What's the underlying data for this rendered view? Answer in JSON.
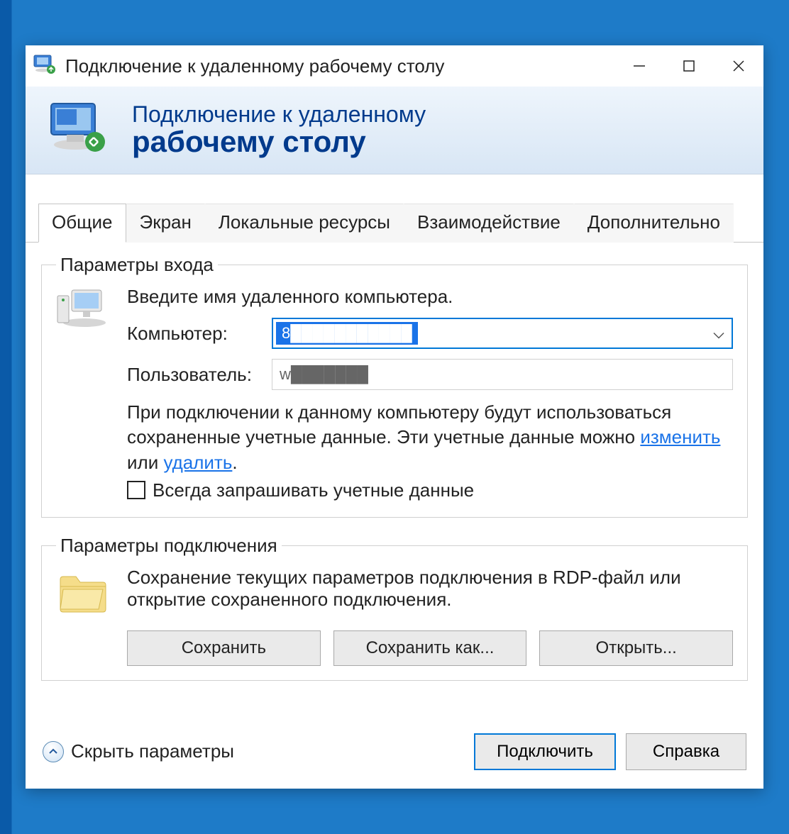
{
  "titlebar": {
    "title": "Подключение к удаленному рабочему столу"
  },
  "banner": {
    "line1": "Подключение к удаленному",
    "line2": "рабочему столу"
  },
  "tabs": {
    "general": "Общие",
    "display": "Экран",
    "local_resources": "Локальные ресурсы",
    "experience": "Взаимодействие",
    "advanced": "Дополнительно"
  },
  "logon": {
    "legend": "Параметры входа",
    "instruction": "Введите имя удаленного компьютера.",
    "computer_label": "Компьютер:",
    "computer_value": "8███████████",
    "user_label": "Пользователь:",
    "user_value": "w███████",
    "creds_text_before": "При подключении к данному компьютеру будут использоваться сохраненные учетные данные.  Эти учетные данные можно ",
    "creds_link_edit": "изменить",
    "creds_text_mid": " или ",
    "creds_link_delete": "удалить",
    "creds_text_after": ".",
    "always_ask": "Всегда запрашивать учетные данные"
  },
  "connection": {
    "legend": "Параметры подключения",
    "description": "Сохранение текущих параметров подключения в RDP-файл или открытие сохраненного подключения.",
    "save": "Сохранить",
    "save_as": "Сохранить как...",
    "open": "Открыть..."
  },
  "footer": {
    "hide_options": "Скрыть параметры",
    "connect": "Подключить",
    "help": "Справка"
  }
}
